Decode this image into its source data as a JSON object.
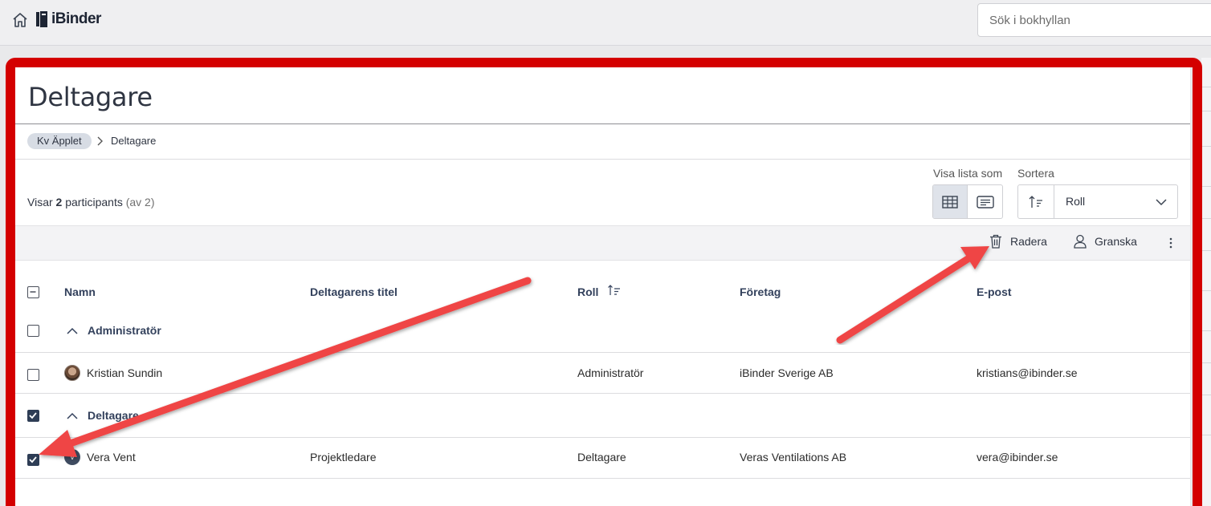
{
  "app": {
    "name": "iBinder"
  },
  "search": {
    "placeholder": "Sök i bokhyllan"
  },
  "page": {
    "title": "Deltagare"
  },
  "breadcrumb": {
    "parent": "Kv Äpplet",
    "current": "Deltagare"
  },
  "summary": {
    "prefix": "Visar",
    "count": "2",
    "noun": "participants",
    "total": "(av 2)"
  },
  "view": {
    "label": "Visa lista som",
    "active": "table"
  },
  "sort": {
    "label": "Sortera",
    "value": "Roll"
  },
  "toolbar": {
    "delete_label": "Radera",
    "review_label": "Granska"
  },
  "table": {
    "headers": {
      "name": "Namn",
      "title": "Deltagarens titel",
      "role": "Roll",
      "company": "Företag",
      "email": "E-post"
    },
    "groups": [
      {
        "label": "Administratör",
        "checked": false,
        "rows": [
          {
            "name": "Kristian Sundin",
            "title": "",
            "role": "Administratör",
            "company": "iBinder Sverige AB",
            "email": "kristians@ibinder.se",
            "checked": false
          }
        ]
      },
      {
        "label": "Deltagare",
        "checked": true,
        "rows": [
          {
            "initial": "V",
            "name": "Vera Vent",
            "title": "Projektledare",
            "role": "Deltagare",
            "company": "Veras Ventilations AB",
            "email": "vera@ibinder.se",
            "checked": true
          }
        ]
      }
    ]
  },
  "colors": {
    "highlight": "#d40000",
    "annotation_arrow": "#ef4444",
    "accent": "#2e3d55"
  }
}
